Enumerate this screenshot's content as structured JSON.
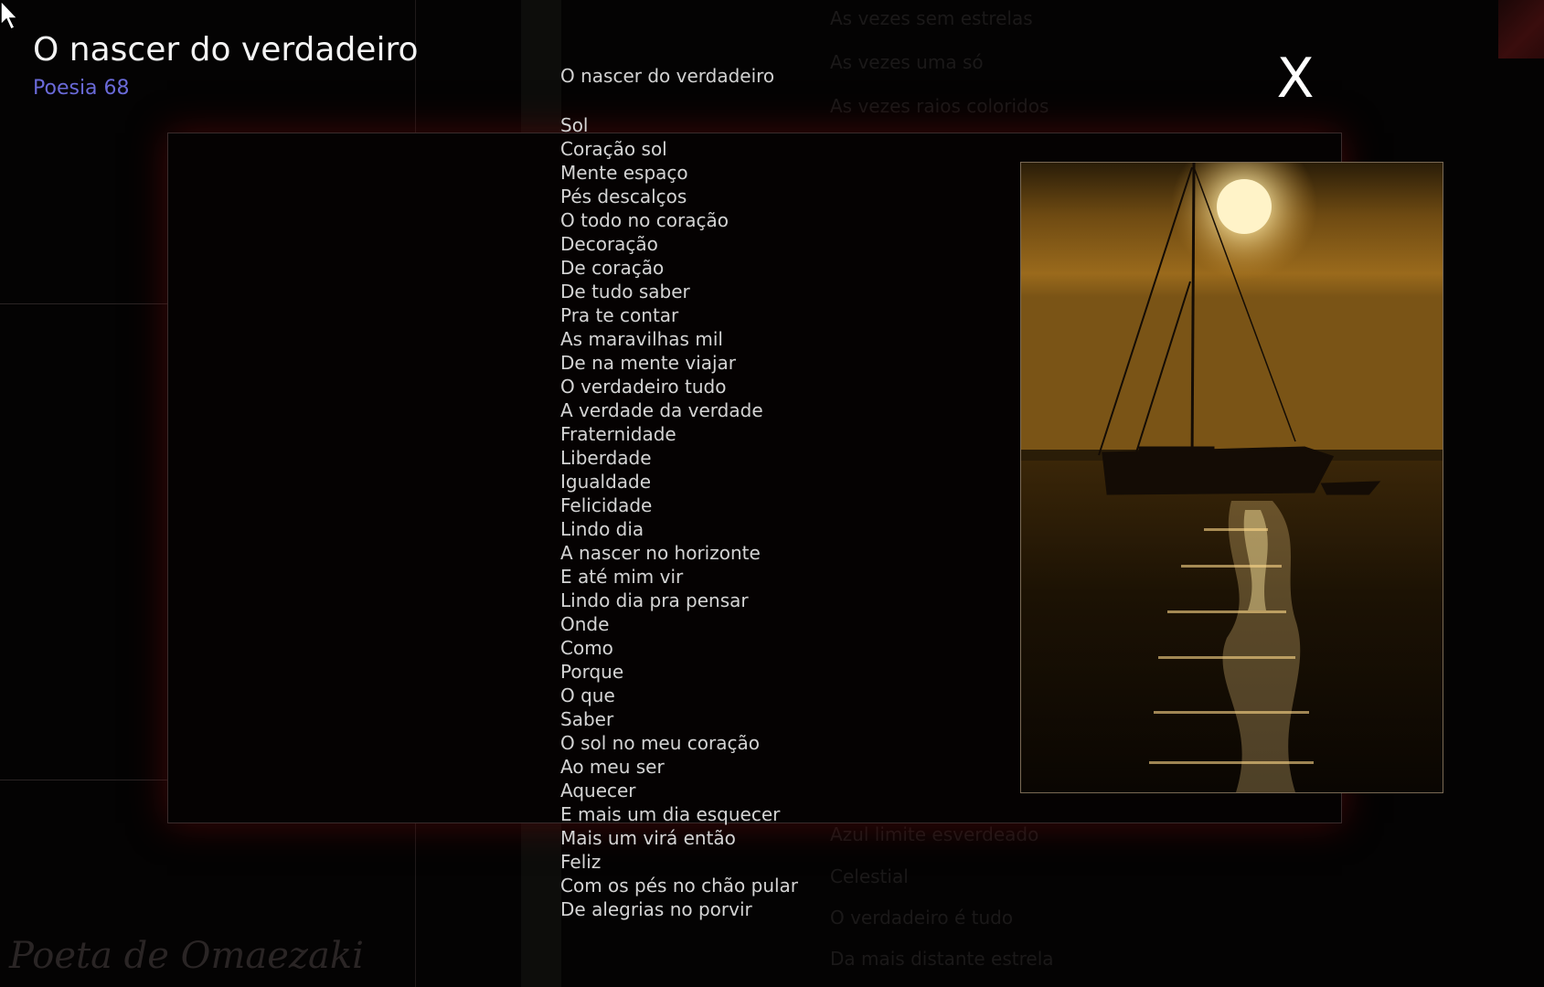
{
  "window": {
    "title": "O nascer do verdadeiro",
    "subtitle": "Poesia 68",
    "close_label": "X",
    "signature": "Poeta de Omaezaki"
  },
  "poem": {
    "title": "O nascer do verdadeiro",
    "lines": [
      "Sol",
      "Coração sol",
      "Mente espaço",
      "Pés descalços",
      "O todo no coração",
      "Decoração",
      "De coração",
      "De tudo saber",
      "Pra te contar",
      "As maravilhas mil",
      "De na mente viajar",
      "O verdadeiro tudo",
      "A verdade da verdade",
      "Fraternidade",
      "Liberdade",
      "Igualdade",
      "Felicidade",
      "Lindo dia",
      "A nascer no horizonte",
      "E até mim vir",
      "Lindo dia pra pensar",
      "Onde",
      "Como",
      "Porque",
      "O que",
      "Saber",
      "O sol no meu coração",
      "Ao meu ser",
      "Aquecer",
      "E mais um dia esquecer",
      "Mais um virá então",
      "Feliz",
      "Com os pés no chão pular",
      "De alegrias no porvir"
    ]
  },
  "background_text": {
    "lines": [
      "As vezes sem estrelas",
      "As vezes uma só",
      "As vezes raios coloridos",
      "Azul limite esverdeado",
      "Celestial",
      "O verdadeiro é tudo",
      "Da mais distante estrela"
    ]
  },
  "photo": {
    "subject": "sailboat silhouette at sunset",
    "colors": {
      "sky_top": "#2a1d08",
      "sky_mid": "#9a6a1c",
      "sun": "#fff3c8",
      "water": "#140c03",
      "glint": "#ffd98a"
    }
  },
  "colors": {
    "background": "#040303",
    "panel_glow": "#6e0a0a",
    "subtitle": "#6a6ad8",
    "poem_text": "#d4d4d4"
  },
  "icons": {
    "cursor": "mouse-pointer-icon"
  }
}
